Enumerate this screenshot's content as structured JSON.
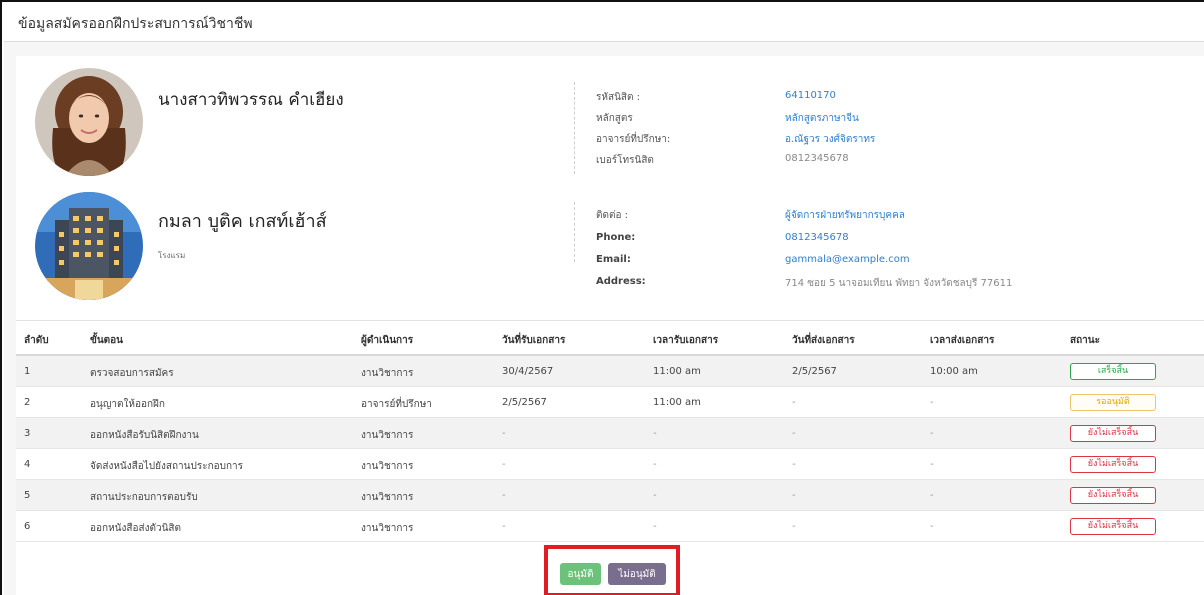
{
  "page": {
    "title": "ข้อมูลสมัครออกฝึกประสบการณ์วิชาชีพ"
  },
  "student": {
    "name": "นางสาวทิพวรรณ คำเฮียง",
    "fields": [
      {
        "label": "รหัสนิสิต :",
        "value": "64110170"
      },
      {
        "label": "หลักสูตร",
        "value": "หลักสูตรภาษาจีน"
      },
      {
        "label": "อาจารย์ที่ปรึกษา:",
        "value": "อ.ณัฐวร วงศ์จิตราทร"
      },
      {
        "label": "เบอร์โทรนิสิต",
        "value": "0812345678"
      }
    ]
  },
  "company": {
    "name": "กมลา บูติค เกสท์เฮ้าส์",
    "type": "โรงแรม",
    "fields": [
      {
        "label": "ติดต่อ :",
        "value": "ผู้จัดการฝ่ายทรัพยากรบุคคล"
      },
      {
        "label": "Phone:",
        "value": "0812345678"
      },
      {
        "label": "Email:",
        "value": "gammala@example.com"
      },
      {
        "label": "Address:",
        "value": "714 ซอย 5 นาจอมเทียน พัทยา จังหวัดชลบุรี 77611"
      }
    ]
  },
  "table": {
    "headers": [
      "ลำดับ",
      "ขั้นตอน",
      "ผู้ดำเนินการ",
      "วันที่รับเอกสาร",
      "เวลารับเอกสาร",
      "วันที่ส่งเอกสาร",
      "เวลาส่งเอกสาร",
      "สถานะ"
    ],
    "rows": [
      {
        "no": "1",
        "step": "ตรวจสอบการสมัคร",
        "actor": "งานวิชาการ",
        "recv_date": "30/4/2567",
        "recv_time": "11:00 am",
        "send_date": "2/5/2567",
        "send_time": "10:00 am",
        "status": "เสร็จสิ้น"
      },
      {
        "no": "2",
        "step": "อนุญาตให้ออกฝึก",
        "actor": "อาจารย์ที่ปรึกษา",
        "recv_date": "2/5/2567",
        "recv_time": "11:00 am",
        "send_date": "-",
        "send_time": "-",
        "status": "รออนุมัติ"
      },
      {
        "no": "3",
        "step": "ออกหนังสือรับนิสิตฝึกงาน",
        "actor": "งานวิชาการ",
        "recv_date": "-",
        "recv_time": "-",
        "send_date": "-",
        "send_time": "-",
        "status": "ยังไม่เสร็จสิ้น"
      },
      {
        "no": "4",
        "step": "จัดส่งหนังสือไปยังสถานประกอบการ",
        "actor": "งานวิชาการ",
        "recv_date": "-",
        "recv_time": "-",
        "send_date": "-",
        "send_time": "-",
        "status": "ยังไม่เสร็จสิ้น"
      },
      {
        "no": "5",
        "step": "สถานประกอบการตอบรับ",
        "actor": "งานวิชาการ",
        "recv_date": "-",
        "recv_time": "-",
        "send_date": "-",
        "send_time": "-",
        "status": "ยังไม่เสร็จสิ้น"
      },
      {
        "no": "6",
        "step": "ออกหนังสือส่งตัวนิสิต",
        "actor": "งานวิชาการ",
        "recv_date": "-",
        "recv_time": "-",
        "send_date": "-",
        "send_time": "-",
        "status": "ยังไม่เสร็จสิ้น"
      }
    ]
  },
  "actions": {
    "approve": "อนุมัติ",
    "reject": "ไม่อนุมัติ"
  },
  "colors": {
    "link": "#2f7fd1",
    "status_done": "#28a745",
    "status_pending": "#e0a800",
    "status_notdone": "#dc3545",
    "approve_button": "#6cc27a",
    "reject_button": "#7a6e8f",
    "highlight_box": "#e31b23"
  },
  "icons": {
    "student_avatar": "student-photo",
    "company_avatar": "hotel-building-photo"
  }
}
